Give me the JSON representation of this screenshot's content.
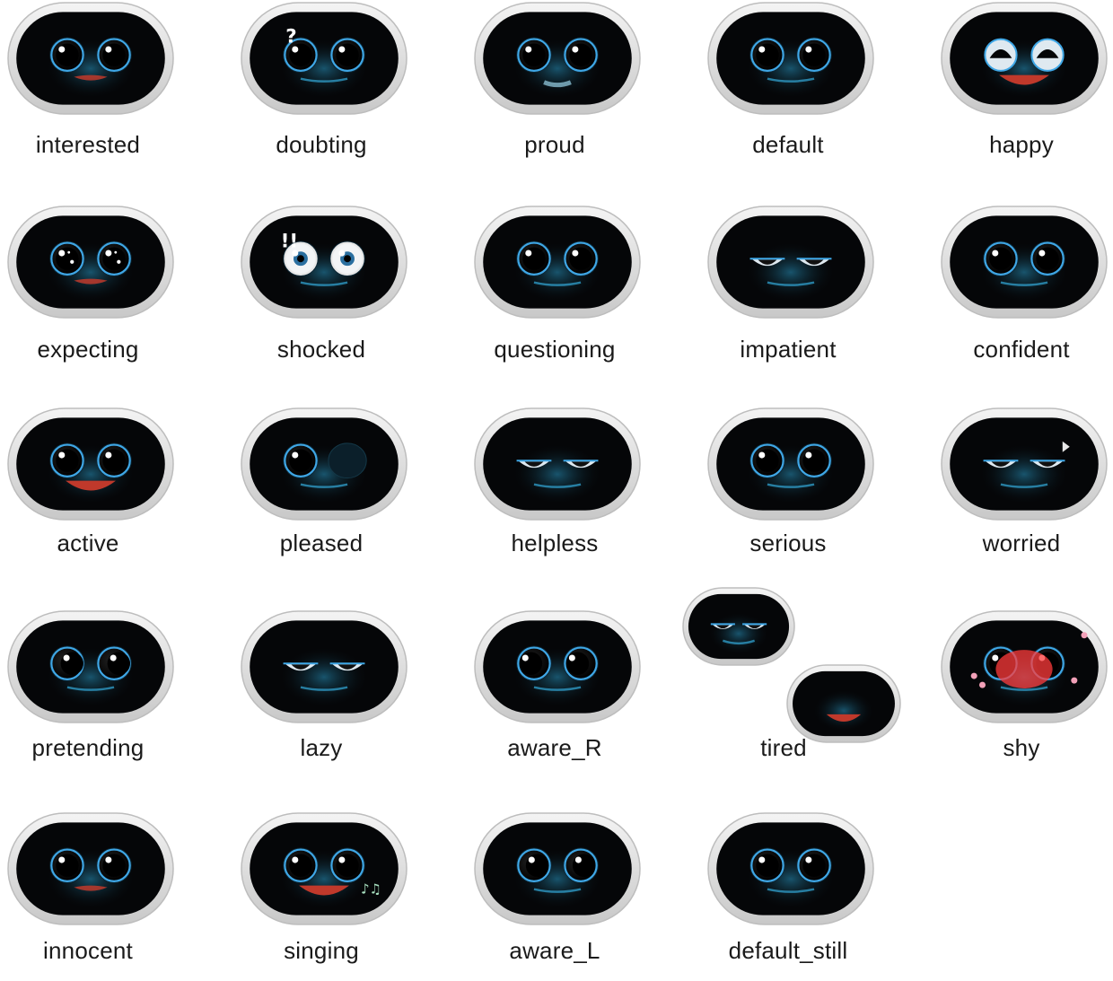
{
  "palette": {
    "bezel_light": "#f4f4f4",
    "bezel_dark": "#c8c8c8",
    "screen": "#050608",
    "glow": "#1f6f8f",
    "eye_ring": "#3fa7e6",
    "mouth": "#c0392b",
    "blush": "#ff3b3b"
  },
  "faces": [
    {
      "label": "interested",
      "eyes": "round",
      "mouth": "beak",
      "extra": ""
    },
    {
      "label": "doubting",
      "eyes": "round",
      "mouth": "flat",
      "extra": "question"
    },
    {
      "label": "proud",
      "eyes": "round",
      "mouth": "smirk",
      "extra": ""
    },
    {
      "label": "default",
      "eyes": "round",
      "mouth": "flat",
      "extra": ""
    },
    {
      "label": "happy",
      "eyes": "happy",
      "mouth": "open",
      "extra": ""
    },
    {
      "label": "expecting",
      "eyes": "sparkle",
      "mouth": "beak",
      "extra": ""
    },
    {
      "label": "shocked",
      "eyes": "white",
      "mouth": "flat",
      "extra": "exclaim"
    },
    {
      "label": "questioning",
      "eyes": "round",
      "mouth": "flat",
      "extra": ""
    },
    {
      "label": "impatient",
      "eyes": "half",
      "mouth": "flat",
      "extra": ""
    },
    {
      "label": "confident",
      "eyes": "round",
      "mouth": "flat",
      "extra": ""
    },
    {
      "label": "active",
      "eyes": "round",
      "mouth": "open",
      "extra": ""
    },
    {
      "label": "pleased",
      "eyes": "wink",
      "mouth": "flat",
      "extra": ""
    },
    {
      "label": "helpless",
      "eyes": "half",
      "mouth": "flat",
      "extra": ""
    },
    {
      "label": "serious",
      "eyes": "round",
      "mouth": "flat",
      "extra": ""
    },
    {
      "label": "worried",
      "eyes": "half",
      "mouth": "flat",
      "extra": "sweat"
    },
    {
      "label": "pretending",
      "eyes": "side",
      "mouth": "flat",
      "extra": ""
    },
    {
      "label": "lazy",
      "eyes": "half",
      "mouth": "flat",
      "extra": ""
    },
    {
      "label": "aware_R",
      "eyes": "round",
      "mouth": "flat",
      "extra": ""
    },
    {
      "label": "tired",
      "eyes": "none",
      "mouth": "none",
      "extra": "tired"
    },
    {
      "label": "shy",
      "eyes": "round",
      "mouth": "flat",
      "extra": "blush"
    },
    {
      "label": "innocent",
      "eyes": "round",
      "mouth": "beak",
      "extra": ""
    },
    {
      "label": "singing",
      "eyes": "round",
      "mouth": "open",
      "extra": "notes"
    },
    {
      "label": "aware_L",
      "eyes": "round",
      "mouth": "flat",
      "extra": ""
    },
    {
      "label": "default_still",
      "eyes": "round",
      "mouth": "flat",
      "extra": ""
    }
  ]
}
